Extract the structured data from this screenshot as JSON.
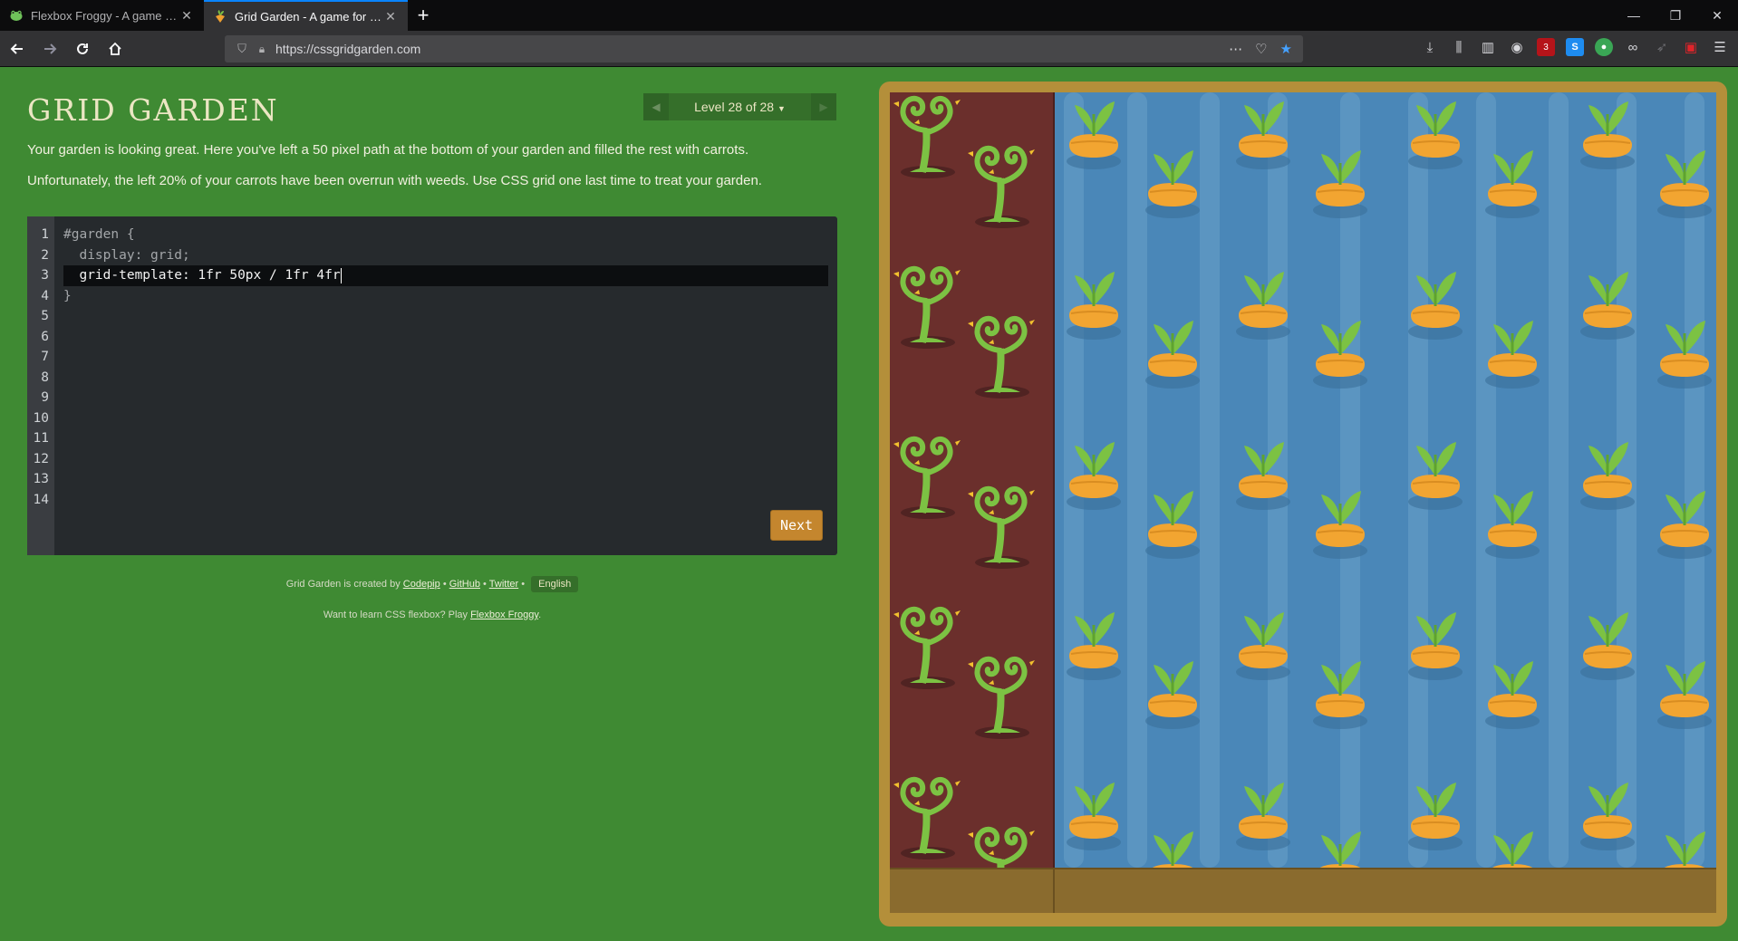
{
  "browser": {
    "tabs": [
      {
        "title": "Flexbox Froggy - A game for learning CSS flexbox",
        "icon": "frog-icon",
        "active": false
      },
      {
        "title": "Grid Garden - A game for learning CSS grid",
        "icon": "carrot-icon",
        "active": true
      }
    ],
    "new_tab": "+",
    "url": "https://cssgridgarden.com",
    "window_controls": {
      "minimize": "—",
      "restore": "❐",
      "close": "✕"
    },
    "ext_badge": "3"
  },
  "game": {
    "title": "GRID GARDEN",
    "level_label": "Level 28 of 28",
    "level_caret": "▼",
    "instructions": [
      "Your garden is looking great. Here you've left a 50 pixel path at the bottom of your garden and filled the rest with carrots.",
      "Unfortunately, the left 20% of your carrots have been overrun with weeds. Use CSS grid one last time to treat your garden."
    ],
    "editor": {
      "line_numbers": [
        "1",
        "2",
        "3",
        "4",
        "5",
        "6",
        "7",
        "8",
        "9",
        "10",
        "11",
        "12",
        "13",
        "14"
      ],
      "line1": "#garden {",
      "line2": "  display: grid;",
      "input_value": "grid-template: 1fr 50px / 1fr 4fr",
      "line4": "}",
      "next_label": "Next"
    },
    "footer": {
      "credit_prefix": "Grid Garden is created by",
      "codepip": "Codepip",
      "github": "GitHub",
      "twitter": "Twitter",
      "sep": "•",
      "language": "English",
      "flexbox_prefix": "Want to learn CSS flexbox? Play",
      "flexbox_link": "Flexbox Froggy",
      "period": "."
    }
  },
  "colors": {
    "page_bg": "#3f8a33",
    "weeds": "#6b2f2c",
    "water": "#4a87b8",
    "soil_path": "#8a6b2e",
    "board_frame": "#b48f3a",
    "next_button": "#c4862e"
  }
}
